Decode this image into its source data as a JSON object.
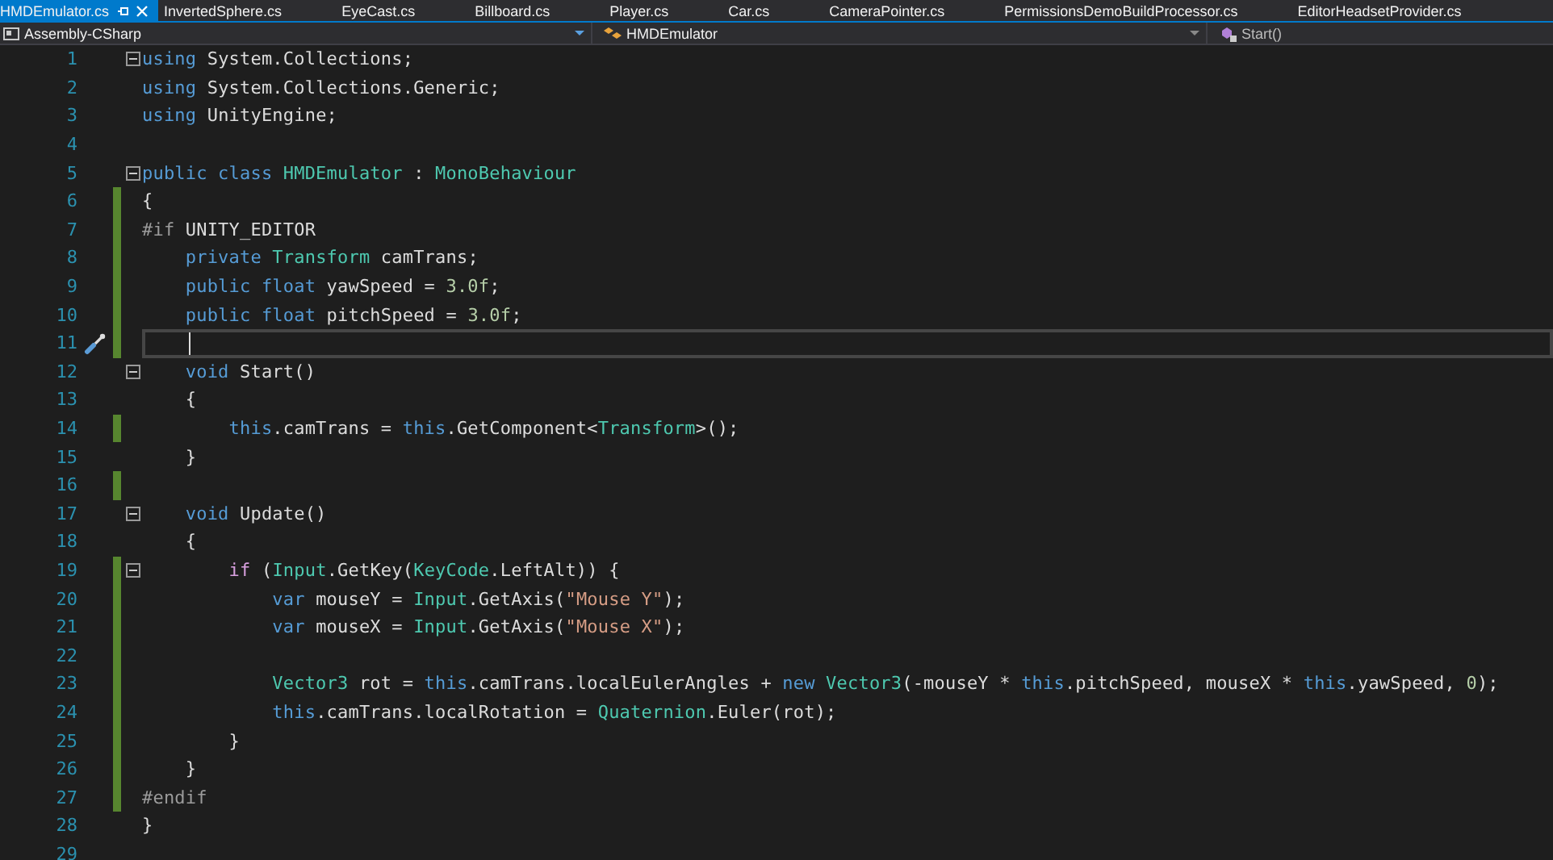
{
  "tabs": [
    {
      "label": "HMDEmulator.cs",
      "selected": true
    },
    {
      "label": "InvertedSphere.cs",
      "selected": false
    },
    {
      "label": "EyeCast.cs",
      "selected": false
    },
    {
      "label": "Billboard.cs",
      "selected": false
    },
    {
      "label": "Player.cs",
      "selected": false
    },
    {
      "label": "Car.cs",
      "selected": false
    },
    {
      "label": "CameraPointer.cs",
      "selected": false
    },
    {
      "label": "PermissionsDemoBuildProcessor.cs",
      "selected": false
    },
    {
      "label": "EditorHeadsetProvider.cs",
      "selected": false
    }
  ],
  "navigation_bar": {
    "project": "Assembly-CSharp",
    "type": "HMDEmulator",
    "member": "Start()"
  },
  "editor": {
    "lines": [
      {
        "number": "1",
        "changed": false,
        "fold": true,
        "current": false,
        "tokens": [
          {
            "kind": "kw",
            "text": "using"
          },
          {
            "kind": "txt",
            "text": " System.Collections;"
          }
        ]
      },
      {
        "number": "2",
        "changed": false,
        "fold": false,
        "current": false,
        "tokens": [
          {
            "kind": "kw",
            "text": "using"
          },
          {
            "kind": "txt",
            "text": " System.Collections.Generic;"
          }
        ]
      },
      {
        "number": "3",
        "changed": false,
        "fold": false,
        "current": false,
        "tokens": [
          {
            "kind": "kw",
            "text": "using"
          },
          {
            "kind": "txt",
            "text": " UnityEngine;"
          }
        ]
      },
      {
        "number": "4",
        "changed": false,
        "fold": false,
        "current": false
      },
      {
        "number": "5",
        "changed": false,
        "fold": true,
        "current": false,
        "tokens": [
          {
            "kind": "kw",
            "text": "public class"
          },
          {
            "kind": "type",
            "text": " HMDEmulator"
          },
          {
            "kind": "txt",
            "text": " : "
          },
          {
            "kind": "type",
            "text": "MonoBehaviour"
          }
        ]
      },
      {
        "number": "6",
        "changed": true,
        "fold": false,
        "current": false,
        "tokens": [
          {
            "kind": "txt",
            "text": "{"
          }
        ]
      },
      {
        "number": "7",
        "changed": true,
        "fold": false,
        "current": false,
        "tokens": [
          {
            "kind": "pre",
            "text": "#if"
          },
          {
            "kind": "txt",
            "text": " UNITY_EDITOR"
          }
        ]
      },
      {
        "number": "8",
        "changed": true,
        "fold": false,
        "current": false,
        "tokens": [
          {
            "kind": "kw",
            "text": "    private"
          },
          {
            "kind": "type",
            "text": " Transform"
          },
          {
            "kind": "txt",
            "text": " camTrans;"
          }
        ]
      },
      {
        "number": "9",
        "changed": true,
        "fold": false,
        "current": false,
        "tokens": [
          {
            "kind": "kw",
            "text": "    public float"
          },
          {
            "kind": "txt",
            "text": " yawSpeed = "
          },
          {
            "kind": "num",
            "text": "3.0f"
          },
          {
            "kind": "txt",
            "text": ";"
          }
        ]
      },
      {
        "number": "10",
        "changed": true,
        "fold": false,
        "current": false,
        "tokens": [
          {
            "kind": "kw",
            "text": "    public float"
          },
          {
            "kind": "txt",
            "text": " pitchSpeed = "
          },
          {
            "kind": "num",
            "text": "3.0f"
          },
          {
            "kind": "txt",
            "text": ";"
          }
        ]
      },
      {
        "number": "11",
        "changed": true,
        "fold": false,
        "current": true
      },
      {
        "number": "12",
        "changed": false,
        "fold": true,
        "current": false,
        "tokens": [
          {
            "kind": "kw",
            "text": "    void"
          },
          {
            "kind": "txt",
            "text": " Start()"
          }
        ]
      },
      {
        "number": "13",
        "changed": false,
        "fold": false,
        "current": false,
        "tokens": [
          {
            "kind": "txt",
            "text": "    {"
          }
        ]
      },
      {
        "number": "14",
        "changed": true,
        "fold": false,
        "current": false,
        "tokens": [
          {
            "kind": "kw",
            "text": "        this"
          },
          {
            "kind": "txt",
            "text": ".camTrans = "
          },
          {
            "kind": "kw",
            "text": "this"
          },
          {
            "kind": "txt",
            "text": ".GetComponent<"
          },
          {
            "kind": "type",
            "text": "Transform"
          },
          {
            "kind": "txt",
            "text": ">();"
          }
        ]
      },
      {
        "number": "15",
        "changed": false,
        "fold": false,
        "current": false,
        "tokens": [
          {
            "kind": "txt",
            "text": "    }"
          }
        ]
      },
      {
        "number": "16",
        "changed": true,
        "fold": false,
        "current": false
      },
      {
        "number": "17",
        "changed": false,
        "fold": true,
        "current": false,
        "tokens": [
          {
            "kind": "kw",
            "text": "    void"
          },
          {
            "kind": "txt",
            "text": " Update()"
          }
        ]
      },
      {
        "number": "18",
        "changed": false,
        "fold": false,
        "current": false,
        "tokens": [
          {
            "kind": "txt",
            "text": "    {"
          }
        ]
      },
      {
        "number": "19",
        "changed": true,
        "fold": true,
        "current": false,
        "tokens": [
          {
            "kind": "ctl",
            "text": "        if"
          },
          {
            "kind": "txt",
            "text": " ("
          },
          {
            "kind": "type",
            "text": "Input"
          },
          {
            "kind": "txt",
            "text": ".GetKey("
          },
          {
            "kind": "type",
            "text": "KeyCode"
          },
          {
            "kind": "txt",
            "text": ".LeftAlt)) {"
          }
        ]
      },
      {
        "number": "20",
        "changed": true,
        "fold": false,
        "current": false,
        "tokens": [
          {
            "kind": "kw",
            "text": "            var"
          },
          {
            "kind": "txt",
            "text": " mouseY = "
          },
          {
            "kind": "type",
            "text": "Input"
          },
          {
            "kind": "txt",
            "text": ".GetAxis("
          },
          {
            "kind": "str",
            "text": "\"Mouse Y\""
          },
          {
            "kind": "txt",
            "text": ");"
          }
        ]
      },
      {
        "number": "21",
        "changed": true,
        "fold": false,
        "current": false,
        "tokens": [
          {
            "kind": "kw",
            "text": "            var"
          },
          {
            "kind": "txt",
            "text": " mouseX = "
          },
          {
            "kind": "type",
            "text": "Input"
          },
          {
            "kind": "txt",
            "text": ".GetAxis("
          },
          {
            "kind": "str",
            "text": "\"Mouse X\""
          },
          {
            "kind": "txt",
            "text": ");"
          }
        ]
      },
      {
        "number": "22",
        "changed": true,
        "fold": false,
        "current": false
      },
      {
        "number": "23",
        "changed": true,
        "fold": false,
        "current": false,
        "tokens": [
          {
            "kind": "type",
            "text": "            Vector3"
          },
          {
            "kind": "txt",
            "text": " rot = "
          },
          {
            "kind": "kw",
            "text": "this"
          },
          {
            "kind": "txt",
            "text": ".camTrans.localEulerAngles + "
          },
          {
            "kind": "kw",
            "text": "new"
          },
          {
            "kind": "type",
            "text": " Vector3"
          },
          {
            "kind": "txt",
            "text": "(-mouseY * "
          },
          {
            "kind": "kw",
            "text": "this"
          },
          {
            "kind": "txt",
            "text": ".pitchSpeed, mouseX * "
          },
          {
            "kind": "kw",
            "text": "this"
          },
          {
            "kind": "txt",
            "text": ".yawSpeed, "
          },
          {
            "kind": "num",
            "text": "0"
          },
          {
            "kind": "txt",
            "text": ");"
          }
        ]
      },
      {
        "number": "24",
        "changed": true,
        "fold": false,
        "current": false,
        "tokens": [
          {
            "kind": "kw",
            "text": "            this"
          },
          {
            "kind": "txt",
            "text": ".camTrans.localRotation = "
          },
          {
            "kind": "type",
            "text": "Quaternion"
          },
          {
            "kind": "txt",
            "text": ".Euler(rot);"
          }
        ]
      },
      {
        "number": "25",
        "changed": true,
        "fold": false,
        "current": false,
        "tokens": [
          {
            "kind": "txt",
            "text": "        }"
          }
        ]
      },
      {
        "number": "26",
        "changed": true,
        "fold": false,
        "current": false,
        "tokens": [
          {
            "kind": "txt",
            "text": "    }"
          }
        ]
      },
      {
        "number": "27",
        "changed": true,
        "fold": false,
        "current": false,
        "tokens": [
          {
            "kind": "pre",
            "text": "#endif"
          }
        ]
      },
      {
        "number": "28",
        "changed": false,
        "fold": false,
        "current": false,
        "tokens": [
          {
            "kind": "txt",
            "text": "}"
          }
        ]
      },
      {
        "number": "29",
        "changed": false,
        "fold": false,
        "current": false
      }
    ]
  }
}
